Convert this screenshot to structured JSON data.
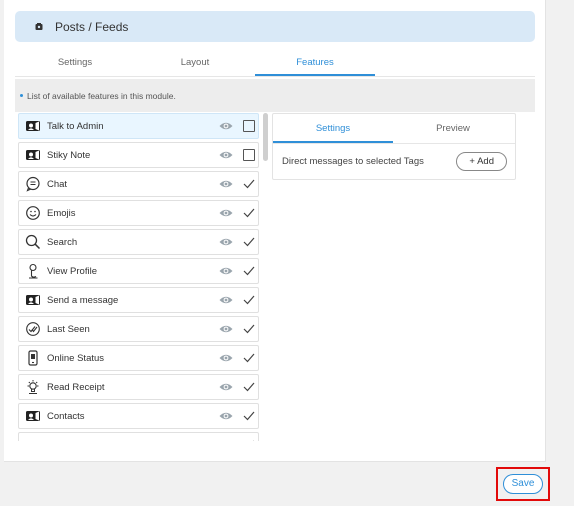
{
  "header": {
    "title": "Posts / Feeds",
    "icon": "module-icon"
  },
  "tabs": [
    {
      "label": "Settings",
      "active": false
    },
    {
      "label": "Layout",
      "active": false
    },
    {
      "label": "Features",
      "active": true
    }
  ],
  "info": {
    "text": "List of available features in this module."
  },
  "features": [
    {
      "label": "Talk to Admin",
      "icon": "video-chat-icon",
      "enabled": false,
      "selected": true
    },
    {
      "label": "Stiky Note",
      "icon": "video-chat-icon",
      "enabled": false,
      "selected": false
    },
    {
      "label": "Chat",
      "icon": "chat-bubble-icon",
      "enabled": true,
      "selected": false
    },
    {
      "label": "Emojis",
      "icon": "smiley-icon",
      "enabled": true,
      "selected": false
    },
    {
      "label": "Search",
      "icon": "search-icon",
      "enabled": true,
      "selected": false
    },
    {
      "label": "View Profile",
      "icon": "profile-icon",
      "enabled": true,
      "selected": false
    },
    {
      "label": "Send a message",
      "icon": "video-chat-icon",
      "enabled": true,
      "selected": false
    },
    {
      "label": "Last Seen",
      "icon": "double-check-icon",
      "enabled": true,
      "selected": false
    },
    {
      "label": "Online Status",
      "icon": "phone-status-icon",
      "enabled": true,
      "selected": false
    },
    {
      "label": "Read Receipt",
      "icon": "bulb-icon",
      "enabled": true,
      "selected": false
    },
    {
      "label": "Contacts",
      "icon": "video-chat-icon",
      "enabled": true,
      "selected": false
    },
    {
      "label": "",
      "icon": "",
      "enabled": true,
      "selected": false
    }
  ],
  "side": {
    "tabs": [
      {
        "label": "Settings",
        "active": true
      },
      {
        "label": "Preview",
        "active": false
      }
    ],
    "row_text": "Direct messages to selected Tags",
    "add_label": "+ Add"
  },
  "footer": {
    "save_label": "Save"
  },
  "colors": {
    "accent": "#2f8fd8",
    "highlight": "#e20a0a",
    "header_bg": "#d9e9f7"
  }
}
